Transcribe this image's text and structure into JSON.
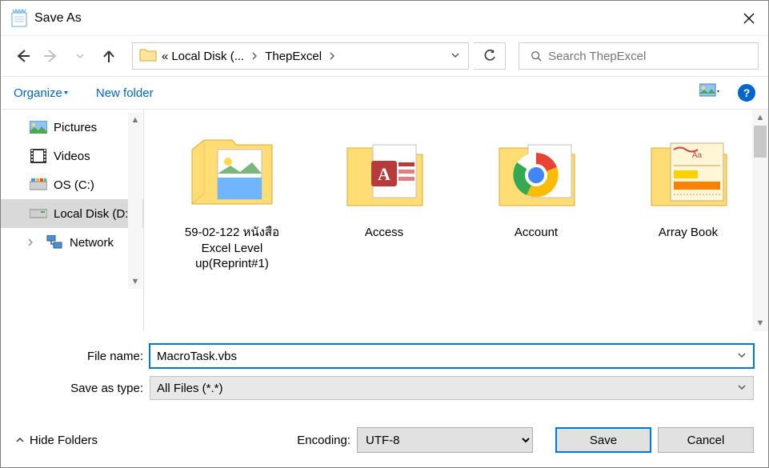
{
  "title": "Save As",
  "breadcrumb": {
    "overflow": "«",
    "p1": "Local Disk (...",
    "p2": "ThepExcel"
  },
  "search": {
    "placeholder": "Search ThepExcel"
  },
  "toolbar": {
    "organize": "Organize",
    "new_folder": "New folder"
  },
  "tree": {
    "items": [
      {
        "label": "Pictures",
        "icon": "pictures"
      },
      {
        "label": "Videos",
        "icon": "videos"
      },
      {
        "label": "OS (C:)",
        "icon": "drive"
      },
      {
        "label": "Local Disk (D:)",
        "icon": "drive",
        "selected": true
      },
      {
        "label": "Network",
        "icon": "network"
      }
    ]
  },
  "folders": {
    "items": [
      {
        "label": "59-02-122 หนังสือ Excel Level up(Reprint#1)",
        "icon": "folder-thumb"
      },
      {
        "label": "Access",
        "icon": "folder-access"
      },
      {
        "label": "Account",
        "icon": "folder-chrome"
      },
      {
        "label": "Array Book",
        "icon": "folder-paper"
      }
    ]
  },
  "fields": {
    "filename_label": "File name:",
    "filename_value": "MacroTask.vbs",
    "filetype_label": "Save as type:",
    "filetype_value": "All Files  (*.*)"
  },
  "encoding": {
    "label": "Encoding:",
    "value": "UTF-8"
  },
  "buttons": {
    "save": "Save",
    "cancel": "Cancel",
    "hide_folders": "Hide Folders"
  }
}
